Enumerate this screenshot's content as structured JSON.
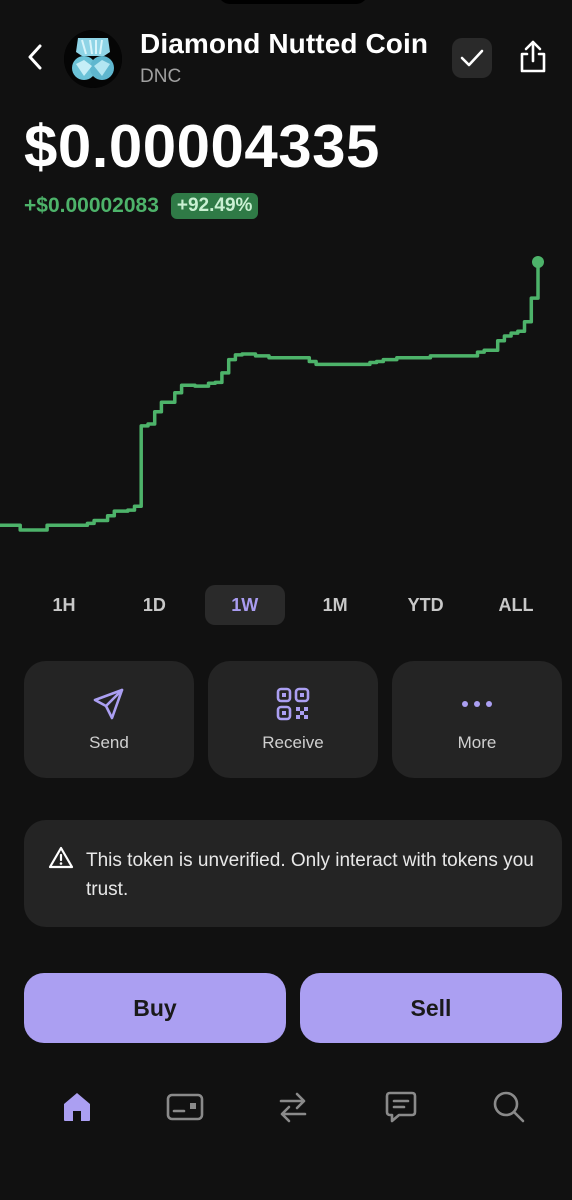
{
  "token": {
    "name": "Diamond Nutted Coin",
    "symbol": "DNC",
    "price": "$0.00004335",
    "change_amount": "+$0.00002083",
    "change_percent": "+92.49%"
  },
  "colors": {
    "accent": "#ab9ff2",
    "positive": "#4db36a",
    "background": "#111111",
    "card": "#242424"
  },
  "chart_data": {
    "type": "line",
    "x": [
      0,
      1,
      2,
      3,
      4,
      5,
      6,
      7,
      8,
      9,
      10,
      11,
      12,
      13,
      14,
      15,
      16,
      17,
      18,
      19,
      20,
      21,
      22,
      23,
      24,
      25,
      26,
      27,
      28,
      29,
      30,
      31,
      32,
      33,
      34,
      35,
      36,
      37,
      38,
      39,
      40,
      41,
      42,
      43,
      44,
      45,
      46,
      47,
      48,
      49,
      50,
      51,
      52,
      53,
      54,
      55,
      56,
      57,
      58,
      59,
      60,
      61,
      62,
      63,
      64,
      65,
      66,
      67,
      68,
      69,
      70,
      71,
      72,
      73,
      74,
      75,
      76,
      77,
      78,
      79,
      80
    ],
    "values": [
      1.55,
      1.55,
      1.55,
      1.5,
      1.5,
      1.5,
      1.5,
      1.55,
      1.55,
      1.55,
      1.55,
      1.55,
      1.55,
      1.57,
      1.6,
      1.6,
      1.65,
      1.7,
      1.7,
      1.71,
      1.75,
      2.6,
      2.62,
      2.75,
      2.85,
      2.85,
      2.95,
      3.03,
      3.03,
      3.02,
      3.02,
      3.05,
      3.06,
      3.16,
      3.3,
      3.35,
      3.36,
      3.36,
      3.34,
      3.34,
      3.32,
      3.32,
      3.32,
      3.32,
      3.32,
      3.32,
      3.28,
      3.25,
      3.25,
      3.25,
      3.25,
      3.25,
      3.25,
      3.25,
      3.25,
      3.27,
      3.28,
      3.3,
      3.3,
      3.32,
      3.32,
      3.32,
      3.32,
      3.32,
      3.34,
      3.34,
      3.34,
      3.34,
      3.34,
      3.34,
      3.34,
      3.38,
      3.4,
      3.4,
      3.5,
      3.55,
      3.58,
      3.6,
      3.7,
      3.95,
      4.3
    ],
    "series_color": "#4db36a",
    "grid": false,
    "range": "1W"
  },
  "timeframes": [
    {
      "label": "1H"
    },
    {
      "label": "1D"
    },
    {
      "label": "1W"
    },
    {
      "label": "1M"
    },
    {
      "label": "YTD"
    },
    {
      "label": "ALL"
    }
  ],
  "actions": {
    "send": "Send",
    "receive": "Receive",
    "more": "More"
  },
  "warning": {
    "text": "This token is unverified. Only interact with tokens you trust."
  },
  "trade": {
    "buy": "Buy",
    "sell": "Sell"
  },
  "icons": {
    "back": "chevron-left-icon",
    "verify": "check-icon",
    "share": "share-icon",
    "send": "paper-plane-icon",
    "receive": "qr-code-icon",
    "more": "ellipsis-icon",
    "warning": "warning-triangle-icon",
    "home": "home-icon",
    "wallet": "card-icon",
    "swap": "swap-icon",
    "messages": "chat-icon",
    "search": "search-icon"
  }
}
